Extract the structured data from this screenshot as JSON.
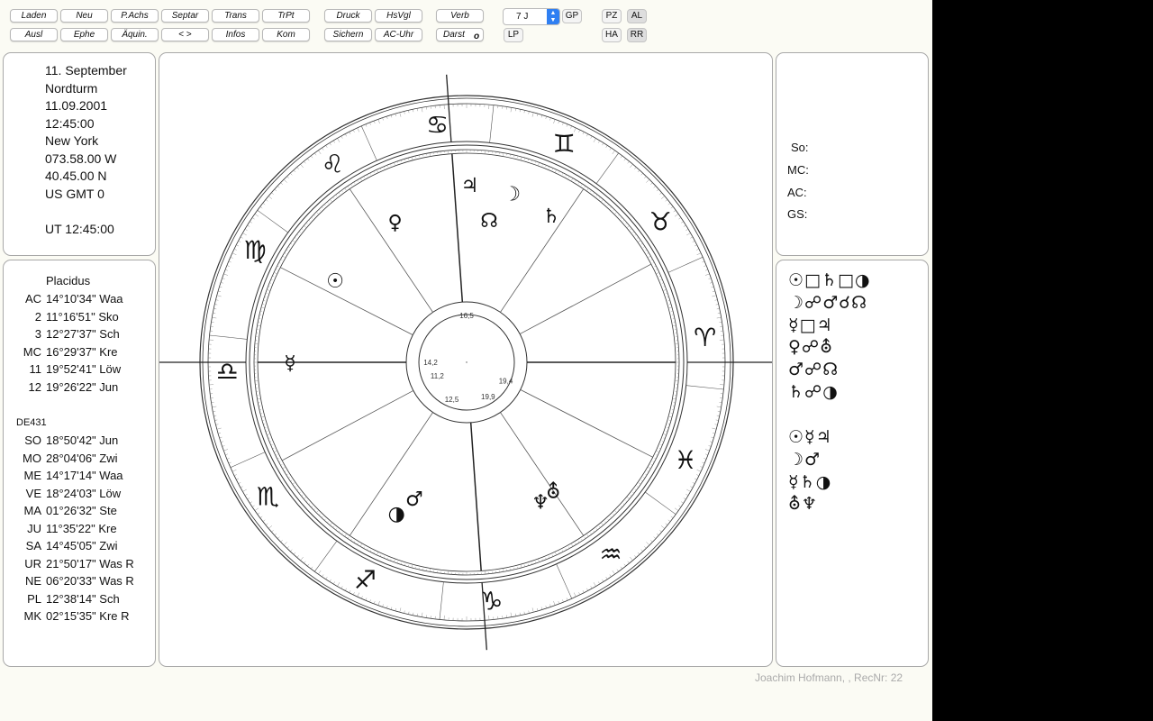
{
  "toolbar": {
    "row1": [
      "Laden",
      "Neu",
      "P.Achs",
      "Septar",
      "Trans",
      "TrPt",
      "Druck",
      "HsVgl",
      "Verb"
    ],
    "row2": [
      "Ausl",
      "Ephe",
      "Äquin.",
      "< >",
      "Infos",
      "Kom",
      "Sichern",
      "AC-Uhr",
      "Darst"
    ],
    "darst_badge": "o",
    "select_value": "7 J",
    "gp": "GP",
    "lp": "LP",
    "pz": "PZ",
    "al": "AL",
    "ha": "HA",
    "rr": "RR"
  },
  "chart_info": {
    "lines": [
      "11. September",
      "Nordturm",
      "11.09.2001",
      "12:45:00",
      "New York",
      "073.58.00 W",
      "40.45.00 N",
      "US GMT 0"
    ],
    "ut": "UT 12:45:00"
  },
  "houses": {
    "system": "Placidus",
    "rows": [
      {
        "label": "AC",
        "value": "14°10'34\" Waa"
      },
      {
        "label": "2",
        "value": "11°16'51\" Sko"
      },
      {
        "label": "3",
        "value": "12°27'37\" Sch"
      },
      {
        "label": "MC",
        "value": "16°29'37\" Kre"
      },
      {
        "label": "11",
        "value": "19°52'41\" Löw"
      },
      {
        "label": "12",
        "value": "19°26'22\" Jun"
      }
    ]
  },
  "ephemeris": {
    "name": "DE431",
    "rows": [
      {
        "label": "SO",
        "value": "18°50'42\" Jun"
      },
      {
        "label": "MO",
        "value": "28°04'06\" Zwi"
      },
      {
        "label": "ME",
        "value": "14°17'14\" Waa"
      },
      {
        "label": "VE",
        "value": "18°24'03\" Löw"
      },
      {
        "label": "MA",
        "value": "01°26'32\" Ste"
      },
      {
        "label": "JU",
        "value": "11°35'22\" Kre"
      },
      {
        "label": "SA",
        "value": "14°45'05\" Zwi"
      },
      {
        "label": "UR",
        "value": "21°50'17\" Was R"
      },
      {
        "label": "NE",
        "value": "06°20'33\" Was R"
      },
      {
        "label": "PL",
        "value": "12°38'14\" Sch"
      },
      {
        "label": "MK",
        "value": "02°15'35\" Kre R"
      }
    ]
  },
  "axes": [
    "So:",
    "MC:",
    "AC:",
    "GS:"
  ],
  "aspects": {
    "group1": [
      "☉□♄□◑",
      "☽☍♂☌☊",
      "☿□♃",
      "♀☍⛢",
      "♂☍☊",
      "♄☍◑"
    ],
    "group2": [
      "☉☿♃",
      "☽♂",
      "☿♄◑",
      "⛢♆"
    ]
  },
  "wheel": {
    "signs": [
      "♋",
      "♊",
      "♉",
      "♈",
      "♓",
      "♒",
      "♑",
      "♐",
      "♏",
      "♎",
      "♍",
      "♌"
    ],
    "planets": [
      "♃",
      "☽",
      "♄",
      "☊",
      "♀",
      "☉",
      "☿",
      "◑",
      "♂",
      "♆",
      "⛢"
    ],
    "hub_numbers": [
      "16,5",
      "14,2",
      "11,2",
      "12,5",
      "19,9",
      "19,4"
    ]
  },
  "footer": "Joachim Hofmann, , RecNr: 22"
}
